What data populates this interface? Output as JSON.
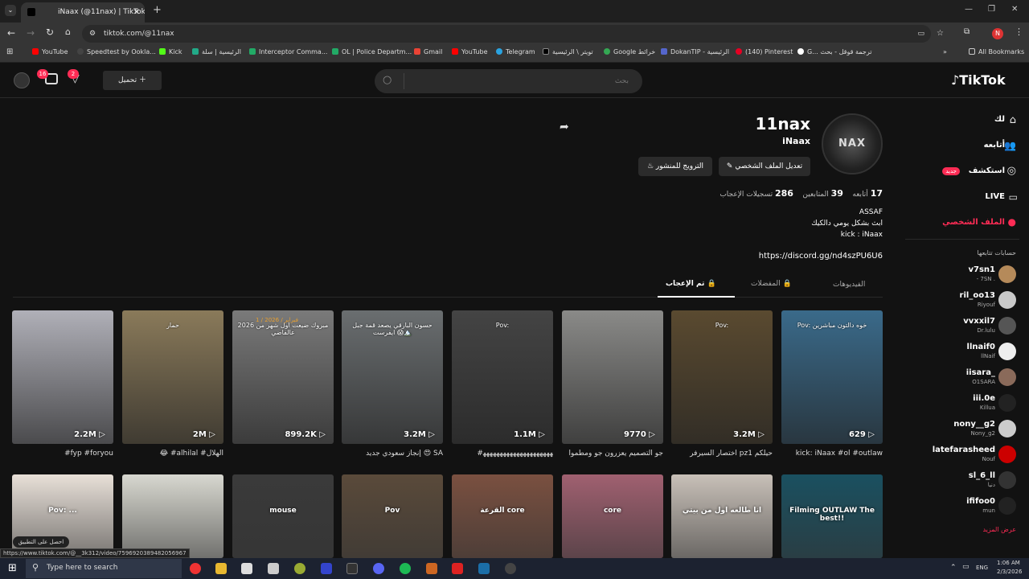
{
  "browser": {
    "tab_title": "iNaax (@11nax) | TikTok",
    "new_tab": "+",
    "url": "tiktok.com/@11nax",
    "profile_letter": "N",
    "all_bookmarks": "All Bookmarks",
    "bookmarks": [
      "YouTube",
      "Speedtest by Ookla...",
      "Kick",
      "الرئيسية | سلة",
      "Interceptor Comma...",
      "OL | Police Departm...",
      "Gmail",
      "YouTube",
      "Telegram",
      "تويتر \\ الرئيسية",
      "Google خرائط",
      "DokanTIP - الرئيسية",
      "(140) Pinterest",
      "G... ترجمة قوقل - بحث"
    ]
  },
  "tiktok": {
    "logo": "TikTok",
    "search_placeholder": "بحث",
    "upload_label": "تحميل",
    "inbox_badge": "16",
    "activity_badge": "2",
    "nav": {
      "foryou": "لك",
      "following": "أتابعه",
      "explore": "استكشف",
      "explore_badge": "جديد",
      "live": "LIVE",
      "profile": "الملف الشخصي"
    },
    "following_header": "حسابات تتابعها",
    "following_accounts": [
      {
        "name": "v7sn1",
        "sub": "- 7SN ."
      },
      {
        "name": "ril_oo13",
        "sub": "Riyouf"
      },
      {
        "name": "vvxxil7",
        "sub": "Dr.lulu"
      },
      {
        "name": "llnaif0",
        "sub": "llNaif"
      },
      {
        "name": "iisara_",
        "sub": "O1SARA"
      },
      {
        "name": "iii.0e",
        "sub": "Killua"
      },
      {
        "name": "nony__g2",
        "sub": "Nony_g2"
      },
      {
        "name": "latefarasheed",
        "sub": "Nouf"
      },
      {
        "name": "sl_6_ll",
        "sub": "دنيا"
      },
      {
        "name": "ififoo0",
        "sub": "mun"
      }
    ],
    "see_more": "عرض المزيد",
    "get_app": "احصل على التطبيق",
    "profile": {
      "username": "11nax",
      "nickname": "iNaax",
      "avatar_text": "NAX",
      "edit_profile": "تعديل الملف الشخصي",
      "promote": "الترويج للمنشور",
      "following_count": "17",
      "following_label": "أتابعه",
      "followers_count": "39",
      "followers_label": "المتابعين",
      "likes_count": "286",
      "likes_label": "تسجيلات الإعجاب",
      "bio_line1": "ASSAF",
      "bio_line2": "ابث بشكل يومي دالكيك",
      "bio_line3": "kick : iNaax",
      "link": "https://discord.gg/nd4szPU6U6"
    },
    "tabs": {
      "videos": "الفيديوهات",
      "favorites": "المفضلات",
      "liked": "تم الإعجاب"
    },
    "videos_row1": [
      {
        "count": "629",
        "caption": "kick: iNaax #ol #outlaw",
        "overlay": "Pov: خوه دالتون مباشرين",
        "color": "#3a6a8a"
      },
      {
        "count": "3.2M",
        "caption": "اختصار السيرفر pz1 حيلكم",
        "overlay": "Pov:",
        "color": "#5a4a30"
      },
      {
        "count": "9770",
        "caption": "جو التصميم يعزرون جو ومطموا",
        "overlay": "",
        "color": "#8a8a88"
      },
      {
        "count": "1.1M",
        "caption": "#ﻬﻬﻬﻬﻬﻬﻬﻬﻬﻬﻬﻬﻬﻬﻬﻬﻬﻬﻬﻬﻬ",
        "overlay": "Pov:",
        "color": "#444"
      },
      {
        "count": "3.2M",
        "caption": "إنجاز سعودي جديد 😍 SA",
        "overlay": "حسون البارقي يصعد قمة جبل ايفرست 😱🏔️",
        "color": "#6a6e70"
      },
      {
        "count": "899.2K",
        "caption": "",
        "overlay": "مبروك ضيعت اول شهر من 2026 عالفاضي",
        "color": "#7a7a7a"
      },
      {
        "count": "2M",
        "caption": "😂 #alhilal #الهلال",
        "overlay": "حمار",
        "color": "#8a7a5a"
      },
      {
        "count": "2.2M",
        "caption": "#fyp #foryou",
        "overlay": "",
        "color": "#b0b0b8"
      }
    ],
    "videos_row1_dates": "1 / فبراير / 2026",
    "videos_row2": [
      {
        "overlay": "Filming OUTLAW The best!!",
        "color": "#1a5060"
      },
      {
        "overlay": "انا طالعه اول من بيتي",
        "color": "#c8c0b8"
      },
      {
        "overlay": "core",
        "color": "#a06070"
      },
      {
        "overlay": "القرعة core",
        "color": "#7a5040"
      },
      {
        "overlay": "Pov",
        "color": "#5a4a3a"
      },
      {
        "overlay": "mouse",
        "color": "#3a3a3a"
      },
      {
        "overlay": "",
        "color": "#d8d8d0"
      },
      {
        "overlay": "Pov: ...",
        "color": "#e8e0d8"
      }
    ]
  },
  "status_url": "https://www.tiktok.com/@__3k312/video/7596920389482056967",
  "taskbar": {
    "search_placeholder": "Type here to search",
    "lang": "ENG",
    "time": "1:06 AM",
    "date": "2/3/2026"
  }
}
